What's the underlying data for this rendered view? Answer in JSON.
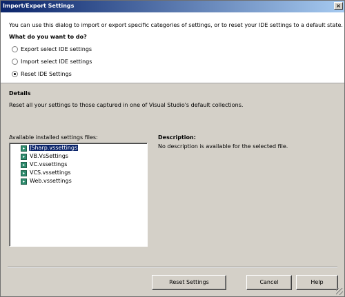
{
  "window": {
    "title": "Import/Export Settings",
    "close_label": "×"
  },
  "intro": {
    "text": "You can use this dialog to import or export specific categories of settings, or to reset your IDE settings to a default state."
  },
  "question": {
    "text": "What do you want to do?"
  },
  "options": [
    {
      "label": "Export select IDE settings",
      "checked": false
    },
    {
      "label": "Import select IDE settings",
      "checked": false
    },
    {
      "label": "Reset IDE Settings",
      "checked": true
    }
  ],
  "details": {
    "title": "Details",
    "text": "Reset all your settings to those captured in one of Visual Studio's default collections."
  },
  "files": {
    "label": "Available installed settings files:",
    "items": [
      {
        "name": "JSharp.vssettings",
        "selected": true
      },
      {
        "name": "VB.VsSettings",
        "selected": false
      },
      {
        "name": "VC.vssettings",
        "selected": false
      },
      {
        "name": "VCS.vssettings",
        "selected": false
      },
      {
        "name": "Web.vssettings",
        "selected": false
      }
    ]
  },
  "description": {
    "title": "Description:",
    "text": "No description is available for the selected file."
  },
  "buttons": {
    "reset": "Reset Settings",
    "cancel": "Cancel",
    "help": "Help"
  },
  "colors": {
    "title_bar": "#0a246a",
    "dialog_face": "#d4d0c8",
    "selection": "#0a246a",
    "file_icon": "#2f8c6e"
  },
  "icons": {
    "file": "settings-file-icon",
    "close": "close-icon"
  }
}
